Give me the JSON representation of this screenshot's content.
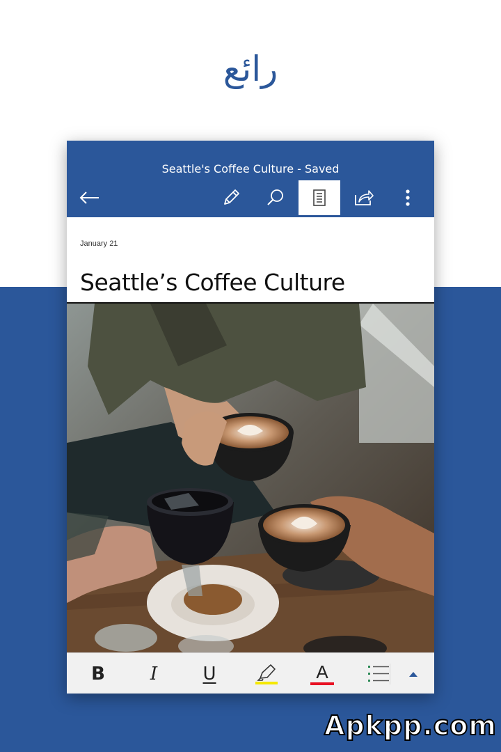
{
  "headline": "رائع",
  "appbar": {
    "title": "Seattle's Coffee Culture - Saved",
    "tools": {
      "back": "back-arrow-icon",
      "edit": "pencil-icon",
      "search": "search-icon",
      "reading_view": "reading-view-icon",
      "share": "share-icon",
      "more": "more-vertical-icon"
    }
  },
  "document": {
    "date": "January 21",
    "heading": "Seattle’s Coffee Culture",
    "image": "photo of people toasting coffee cups and an iced drink over a table"
  },
  "formatting": {
    "bold": "B",
    "italic": "I",
    "underline": "U",
    "highlight_icon": "highlighter-icon",
    "font_color": "A",
    "list_icon": "bullet-list-icon",
    "expand_icon": "caret-up-icon",
    "highlight_color": "#f5e800",
    "font_color_swatch": "#e81123"
  },
  "colors": {
    "accent": "#2b579a"
  },
  "watermark": "Apkpp.com"
}
